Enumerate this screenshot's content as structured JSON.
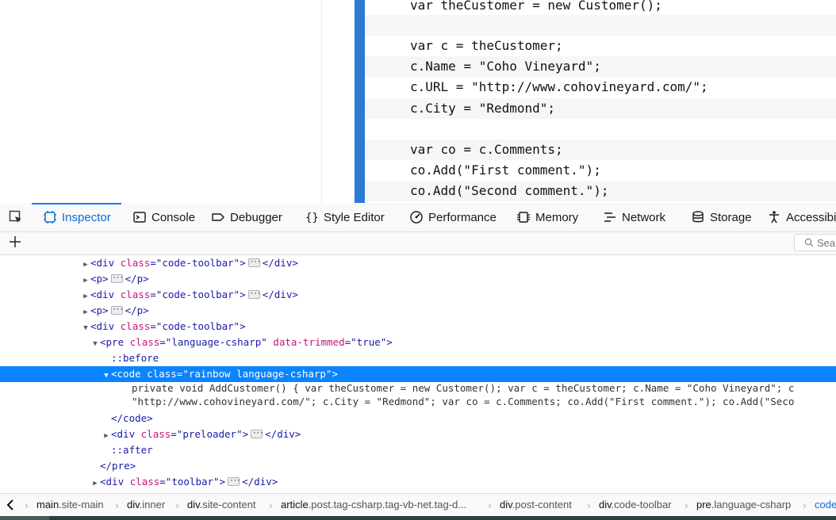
{
  "page": {
    "code_lines": [
      {
        "text": "var theCustomer = new Customer();",
        "alt": false
      },
      {
        "text": "",
        "alt": true
      },
      {
        "text": "var c = theCustomer;",
        "alt": false
      },
      {
        "text": "c.Name = \"Coho Vineyard\";",
        "alt": true
      },
      {
        "text": "c.URL = \"http://www.cohovineyard.com/\";",
        "alt": false
      },
      {
        "text": "c.City = \"Redmond\";",
        "alt": true
      },
      {
        "text": "",
        "alt": false
      },
      {
        "text": "var co = c.Comments;",
        "alt": true
      },
      {
        "text": "co.Add(\"First comment.\");",
        "alt": false
      },
      {
        "text": "co.Add(\"Second comment.\");",
        "alt": true
      }
    ]
  },
  "devtools": {
    "tabs": [
      {
        "label": "Inspector",
        "icon": "inspector-icon",
        "active": true
      },
      {
        "label": "Console",
        "icon": "console-icon",
        "active": false
      },
      {
        "label": "Debugger",
        "icon": "debugger-icon",
        "active": false
      },
      {
        "label": "Style Editor",
        "icon": "braces-icon",
        "active": false
      },
      {
        "label": "Performance",
        "icon": "performance-icon",
        "active": false
      },
      {
        "label": "Memory",
        "icon": "memory-icon",
        "active": false
      },
      {
        "label": "Network",
        "icon": "network-icon",
        "active": false
      },
      {
        "label": "Storage",
        "icon": "storage-icon",
        "active": false
      },
      {
        "label": "Accessibi",
        "icon": "accessibility-icon",
        "active": false
      }
    ],
    "search_placeholder": "Sear",
    "markup": {
      "rows": [
        {
          "depth": 0,
          "twisty": "closed",
          "parts": [
            [
              "tag",
              "<div "
            ],
            [
              "attr",
              "class"
            ],
            [
              "tag",
              "=\""
            ],
            [
              "val",
              "code-toolbar"
            ],
            [
              "tag",
              "\">"
            ],
            [
              "ellip",
              ""
            ],
            [
              "tag",
              "</div>"
            ]
          ]
        },
        {
          "depth": 0,
          "twisty": "closed",
          "parts": [
            [
              "tag",
              "<p>"
            ],
            [
              "ellip",
              ""
            ],
            [
              "tag",
              "</p>"
            ]
          ]
        },
        {
          "depth": 0,
          "twisty": "closed",
          "parts": [
            [
              "tag",
              "<div "
            ],
            [
              "attr",
              "class"
            ],
            [
              "tag",
              "=\""
            ],
            [
              "val",
              "code-toolbar"
            ],
            [
              "tag",
              "\">"
            ],
            [
              "ellip",
              ""
            ],
            [
              "tag",
              "</div>"
            ]
          ]
        },
        {
          "depth": 0,
          "twisty": "closed",
          "parts": [
            [
              "tag",
              "<p>"
            ],
            [
              "ellip",
              ""
            ],
            [
              "tag",
              "</p>"
            ]
          ]
        },
        {
          "depth": 0,
          "twisty": "open",
          "parts": [
            [
              "tag",
              "<div "
            ],
            [
              "attr",
              "class"
            ],
            [
              "tag",
              "=\""
            ],
            [
              "val",
              "code-toolbar"
            ],
            [
              "tag",
              "\">"
            ]
          ]
        },
        {
          "depth": 1,
          "twisty": "open",
          "parts": [
            [
              "tag",
              "<pre "
            ],
            [
              "attr",
              "class"
            ],
            [
              "tag",
              "=\""
            ],
            [
              "val",
              "language-csharp"
            ],
            [
              "tag",
              "\" "
            ],
            [
              "attr",
              "data-trimmed"
            ],
            [
              "tag",
              "=\""
            ],
            [
              "val",
              "true"
            ],
            [
              "tag",
              "\">"
            ]
          ]
        },
        {
          "depth": 2,
          "twisty": "none",
          "parts": [
            [
              "pseudo",
              "::before"
            ]
          ]
        },
        {
          "depth": 2,
          "twisty": "open",
          "selected": true,
          "parts": [
            [
              "tag",
              "<code "
            ],
            [
              "attr",
              "class"
            ],
            [
              "tag",
              "=\""
            ],
            [
              "val",
              "rainbow language-csharp"
            ],
            [
              "tag",
              "\">"
            ]
          ]
        },
        {
          "depth": 3,
          "twisty": "none",
          "text_row": true,
          "parts": [
            [
              "text",
              "private void AddCustomer() { var theCustomer = new Customer(); var c = theCustomer; c.Name = \"Coho Vineyard\"; c"
            ]
          ]
        },
        {
          "depth": 3,
          "twisty": "none",
          "text_row": true,
          "parts": [
            [
              "text",
              "\"http://www.cohovineyard.com/\"; c.City = \"Redmond\"; var co = c.Comments; co.Add(\"First comment.\"); co.Add(\"Seco"
            ]
          ]
        },
        {
          "depth": 2,
          "twisty": "none",
          "parts": [
            [
              "tag",
              "</code>"
            ]
          ]
        },
        {
          "depth": 2,
          "twisty": "closed",
          "parts": [
            [
              "tag",
              "<div "
            ],
            [
              "attr",
              "class"
            ],
            [
              "tag",
              "=\""
            ],
            [
              "val",
              "preloader"
            ],
            [
              "tag",
              "\">"
            ],
            [
              "ellip",
              ""
            ],
            [
              "tag",
              "</div>"
            ]
          ]
        },
        {
          "depth": 2,
          "twisty": "none",
          "parts": [
            [
              "pseudo",
              "::after"
            ]
          ]
        },
        {
          "depth": 1,
          "twisty": "none",
          "parts": [
            [
              "tag",
              "</pre>"
            ]
          ]
        },
        {
          "depth": 1,
          "twisty": "closed",
          "parts": [
            [
              "tag",
              "<div "
            ],
            [
              "attr",
              "class"
            ],
            [
              "tag",
              "=\""
            ],
            [
              "val",
              "toolbar"
            ],
            [
              "tag",
              "\">"
            ],
            [
              "ellip",
              ""
            ],
            [
              "tag",
              "</div>"
            ]
          ]
        }
      ]
    },
    "breadcrumbs": [
      {
        "name": "main",
        "cls": ".site-main"
      },
      {
        "name": "div",
        "cls": ".inner"
      },
      {
        "name": "div",
        "cls": ".site-content"
      },
      {
        "name": "article",
        "cls": ".post.tag-csharp.tag-vb-net.tag-d..."
      },
      {
        "name": "div",
        "cls": ".post-content"
      },
      {
        "name": "div",
        "cls": ".code-toolbar"
      },
      {
        "name": "pre",
        "cls": ".language-csharp"
      },
      {
        "name": "code",
        "cls": ""
      }
    ]
  }
}
